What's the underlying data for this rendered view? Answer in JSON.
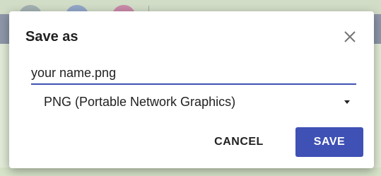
{
  "dialog": {
    "title": "Save as",
    "close_icon": "close-icon",
    "filename": {
      "value": "your name.png"
    },
    "format": {
      "selected": "PNG (Portable Network Graphics)",
      "icon": "dropdown-arrow-icon"
    },
    "buttons": {
      "cancel_label": "CANCEL",
      "save_label": "SAVE"
    }
  },
  "colors": {
    "accent": "#3f51b5",
    "text": "#212121",
    "backdrop": "#e1ebd7"
  }
}
